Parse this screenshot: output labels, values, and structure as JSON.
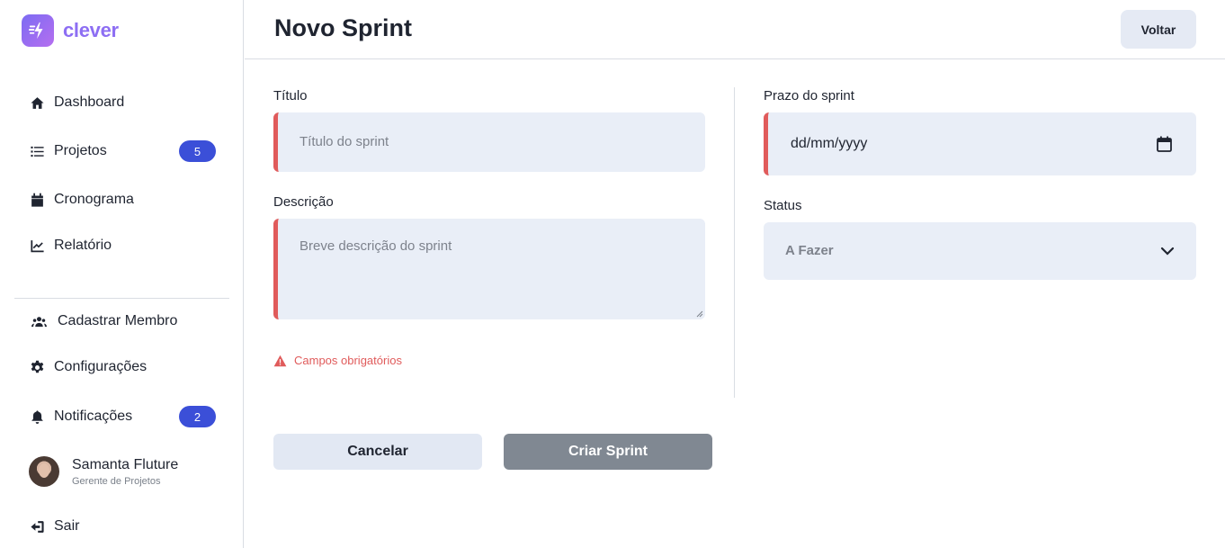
{
  "brand": {
    "name": "clever"
  },
  "sidebar": {
    "items": [
      {
        "label": "Dashboard",
        "icon": "home-icon"
      },
      {
        "label": "Projetos",
        "icon": "list-icon",
        "badge": "5"
      },
      {
        "label": "Cronograma",
        "icon": "calendar-icon"
      },
      {
        "label": "Relatório",
        "icon": "chart-line-icon"
      }
    ],
    "secondary": [
      {
        "label": "Cadastrar Membro",
        "icon": "users-icon"
      },
      {
        "label": "Configurações",
        "icon": "gear-icon"
      },
      {
        "label": "Notificações",
        "icon": "bell-icon",
        "badge": "2"
      }
    ],
    "user": {
      "name": "Samanta Fluture",
      "role": "Gerente de Projetos"
    },
    "logout": {
      "label": "Sair",
      "icon": "sign-out-icon"
    }
  },
  "header": {
    "title": "Novo Sprint",
    "back_label": "Voltar"
  },
  "form": {
    "title": {
      "label": "Título",
      "placeholder": "Título do sprint"
    },
    "description": {
      "label": "Descrição",
      "placeholder": "Breve descrição do sprint"
    },
    "error": "Campos obrigatórios",
    "deadline": {
      "label": "Prazo do sprint",
      "placeholder": "dd/mm/yyyy"
    },
    "status": {
      "label": "Status",
      "value": "A Fazer"
    },
    "cancel_label": "Cancelar",
    "submit_label": "Criar Sprint"
  },
  "colors": {
    "accent": "#3b4fd8",
    "error": "#e05b5b",
    "brand": "#8d6ef3",
    "field_bg": "#e9eef7"
  }
}
